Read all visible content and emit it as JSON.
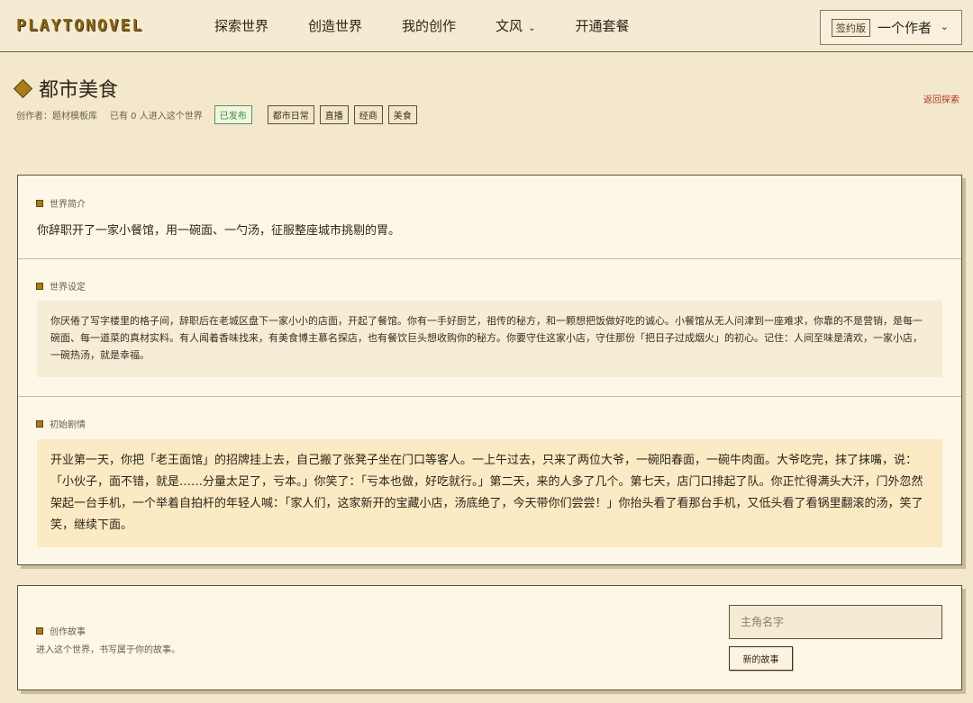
{
  "header": {
    "logo": "PLAYTONOVEL",
    "nav": [
      {
        "label": "探索世界"
      },
      {
        "label": "创造世界"
      },
      {
        "label": "我的创作"
      },
      {
        "label": "文风",
        "has_dropdown": true
      },
      {
        "label": "开通套餐"
      }
    ],
    "user": {
      "plan_badge": "签约版",
      "name": "一个作者"
    }
  },
  "world": {
    "title": "都市美食",
    "creator": "创作者：题材模板库",
    "entered": "已有 0 人进入这个世界",
    "status": "已发布",
    "tags": [
      "都市日常",
      "直播",
      "经商",
      "美食"
    ],
    "return_link": "返回探索"
  },
  "sections": {
    "intro": {
      "label": "世界简介",
      "text": "你辞职开了一家小餐馆，用一碗面、一勺汤，征服整座城市挑剔的胃。"
    },
    "setting": {
      "label": "世界设定",
      "text": "你厌倦了写字楼里的格子间，辞职后在老城区盘下一家小小的店面，开起了餐馆。你有一手好厨艺，祖传的秘方，和一颗想把饭做好吃的诚心。小餐馆从无人问津到一座难求，你靠的不是营销，是每一碗面、每一道菜的真材实料。有人闻着香味找来，有美食博主慕名探店，也有餐饮巨头想收购你的秘方。你要守住这家小店，守住那份「把日子过成烟火」的初心。记住：人间至味是清欢，一家小店，一碗热汤，就是幸福。"
    },
    "plot": {
      "label": "初始剧情",
      "text": "开业第一天，你把「老王面馆」的招牌挂上去，自己搬了张凳子坐在门口等客人。一上午过去，只来了两位大爷，一碗阳春面，一碗牛肉面。大爷吃完，抹了抹嘴，说：「小伙子，面不错，就是……分量太足了，亏本。」你笑了：「亏本也做，好吃就行。」第二天，来的人多了几个。第七天，店门口排起了队。你正忙得满头大汗，门外忽然架起一台手机，一个举着自拍杆的年轻人喊：「家人们，这家新开的宝藏小店，汤底绝了，今天带你们尝尝！」你抬头看了看那台手机，又低头看了看锅里翻滚的汤，笑了笑，继续下面。"
    }
  },
  "create": {
    "label": "创作故事",
    "hint": "进入这个世界，书写属于你的故事。",
    "name_placeholder": "主角名字",
    "button": "新的故事"
  },
  "colors": {
    "page_bg": "#f3e8cc",
    "card_bg": "#fdf7e7",
    "accent": "#a87c1a",
    "published_green": "#3f8a48",
    "return_red": "#b0322a",
    "plot_bg": "#fbeac3"
  },
  "icons": {
    "world_title": "diamond-icon",
    "section_marker": "square-icon",
    "dropdown": "chevron-down-icon"
  }
}
